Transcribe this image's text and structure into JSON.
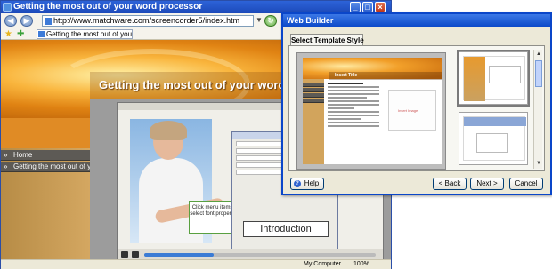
{
  "browser": {
    "window_title": "Getting the most out of your word processor",
    "url": "http://www.matchware.com/screencorder5/index.htm",
    "tab_label": "Getting the most out of your word processor",
    "page": {
      "banner_title": "Getting the most out of your word processor",
      "nav": [
        {
          "label": "Home"
        },
        {
          "label": "Getting the most out of your w..."
        }
      ],
      "video": {
        "callout_text": "Click menu items to select font properties.",
        "intro_text": "Introduction"
      }
    },
    "status": {
      "zone": "My Computer",
      "zoom": "100%"
    }
  },
  "builder": {
    "title": "Web Builder",
    "tab_label": "Select Template Style",
    "preview": {
      "title": "Insert Title",
      "box_text": "Insert Image"
    },
    "buttons": {
      "help": "Help",
      "back": "< Back",
      "next": "Next >",
      "cancel": "Cancel"
    }
  },
  "colors": {
    "xp_title_blue": "#0b49c9",
    "banner_orange": "#e08313",
    "nav_gray": "#5d5a55"
  }
}
